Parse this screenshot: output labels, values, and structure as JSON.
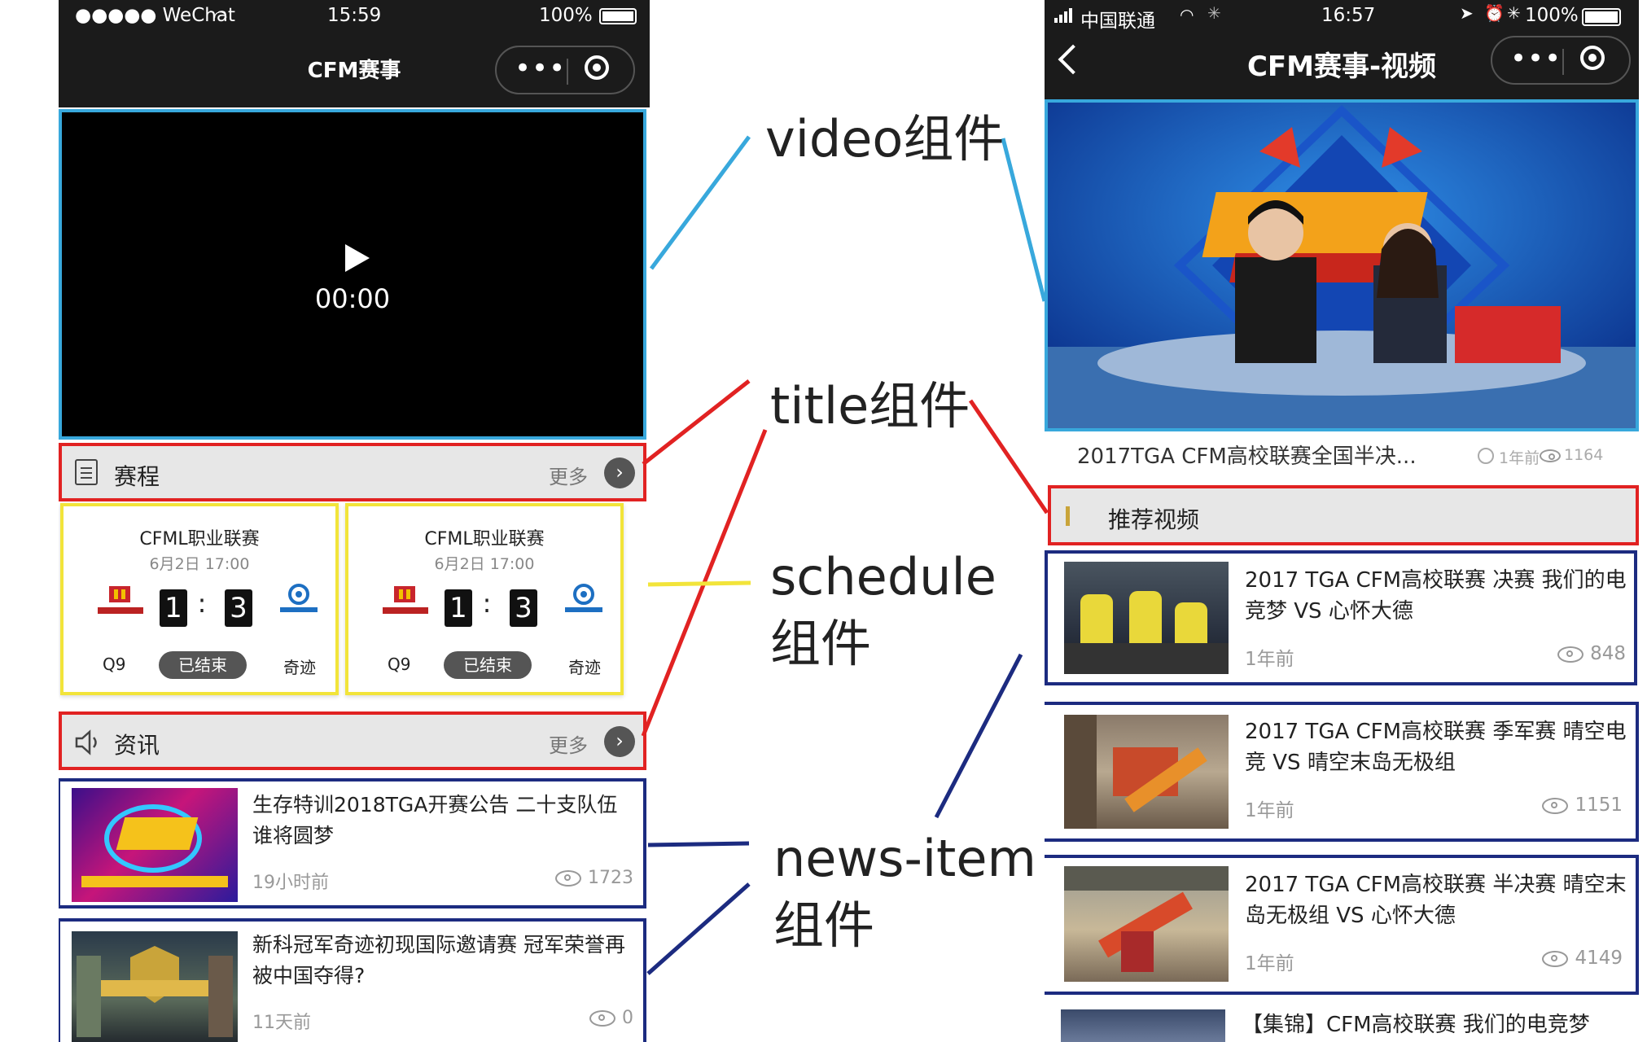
{
  "left_phone": {
    "status": {
      "carrier": "●●●●● WeChat",
      "time": "15:59",
      "battery": "100%"
    },
    "nav_title": "CFM赛事",
    "video": {
      "time": "00:00"
    },
    "schedule_title": {
      "label": "赛程",
      "more": "更多"
    },
    "schedules": [
      {
        "league": "CFML职业联赛",
        "date": "6月2日 17:00",
        "score_left": "1",
        "score_right": "3",
        "team_left": "Q9",
        "team_right": "奇迹",
        "status": "已结束"
      },
      {
        "league": "CFML职业联赛",
        "date": "6月2日 17:00",
        "score_left": "1",
        "score_right": "3",
        "team_left": "Q9",
        "team_right": "奇迹",
        "status": "已结束"
      }
    ],
    "news_title": {
      "label": "资讯",
      "more": "更多"
    },
    "news": [
      {
        "title": "生存特训2018TGA开赛公告 二十支队伍谁将圆梦",
        "time": "19小时前",
        "views": "1723"
      },
      {
        "title": "新科冠军奇迹初现国际邀请赛 冠军荣誉再被中国夺得?",
        "time": "11天前",
        "views": "0"
      }
    ]
  },
  "right_phone": {
    "status": {
      "carrier": "中国联通",
      "time": "16:57",
      "battery": "100%"
    },
    "nav_title": "CFM赛事-视频",
    "video_caption": {
      "title": "2017TGA CFM高校联赛全国半决...",
      "time": "1年前",
      "views": "1164"
    },
    "section_title": "推荐视频",
    "videos": [
      {
        "title": "2017 TGA CFM高校联赛 决赛 我们的电竞梦 VS 心怀大德",
        "time": "1年前",
        "views": "848"
      },
      {
        "title": "2017 TGA CFM高校联赛 季军赛 晴空电竞 VS 晴空末岛无极组",
        "time": "1年前",
        "views": "1151"
      },
      {
        "title": "2017 TGA CFM高校联赛 半决赛 晴空末岛无极组 VS 心怀大德",
        "time": "1年前",
        "views": "4149"
      },
      {
        "title": "【集锦】CFM高校联赛 我们的电竞梦"
      }
    ]
  },
  "annotations": {
    "video": "video组件",
    "title": "title组件",
    "schedule_1": "schedule",
    "schedule_2": "组件",
    "news_1": "news-item",
    "news_2": "组件"
  },
  "colors": {
    "video": "#38a8dc",
    "title": "#e12222",
    "schedule": "#f2e43a",
    "news": "#1c2b80"
  }
}
